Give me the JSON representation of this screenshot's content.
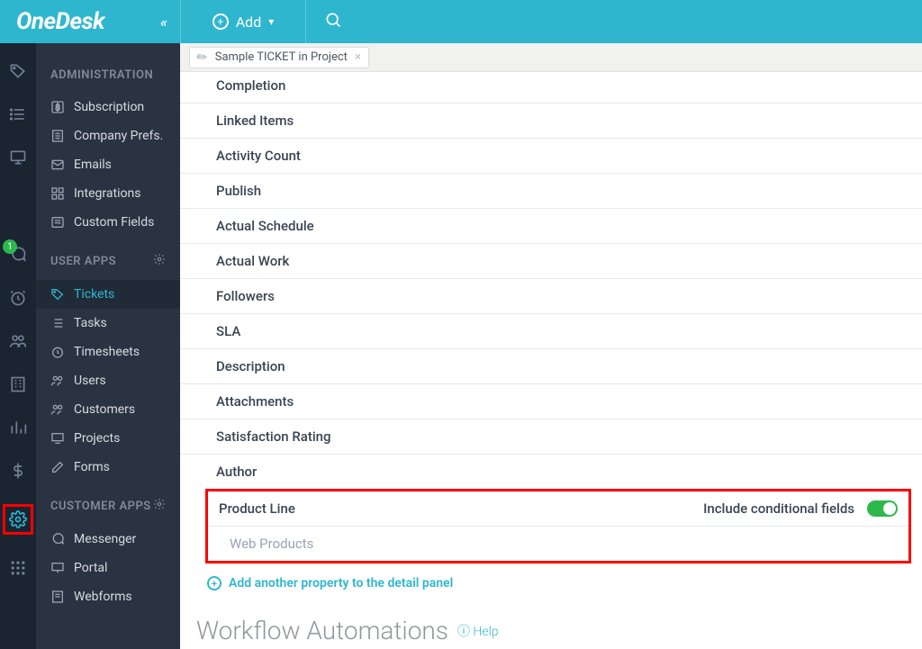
{
  "brand": "OneDesk",
  "add_label": "Add",
  "tab_title": "Sample TICKET in Project",
  "sidebar": {
    "section1": "ADMINISTRATION",
    "admin_items": [
      "Subscription",
      "Company Prefs.",
      "Emails",
      "Integrations",
      "Custom Fields"
    ],
    "section2": "USER APPS",
    "user_items": [
      "Tickets",
      "Tasks",
      "Timesheets",
      "Users",
      "Customers",
      "Projects",
      "Forms"
    ],
    "section3": "CUSTOMER APPS",
    "customer_items": [
      "Messenger",
      "Portal",
      "Webforms"
    ]
  },
  "properties": [
    "Completion",
    "Linked Items",
    "Activity Count",
    "Publish",
    "Actual Schedule",
    "Actual Work",
    "Followers",
    "SLA",
    "Description",
    "Attachments",
    "Satisfaction Rating",
    "Author"
  ],
  "highlight_block": {
    "title": "Product Line",
    "toggle_label": "Include conditional fields",
    "sub": "Web Products"
  },
  "add_property_link": "Add another property to the detail panel",
  "wf_section": "Workflow Automations",
  "wf_help": "Help",
  "badge": "1"
}
